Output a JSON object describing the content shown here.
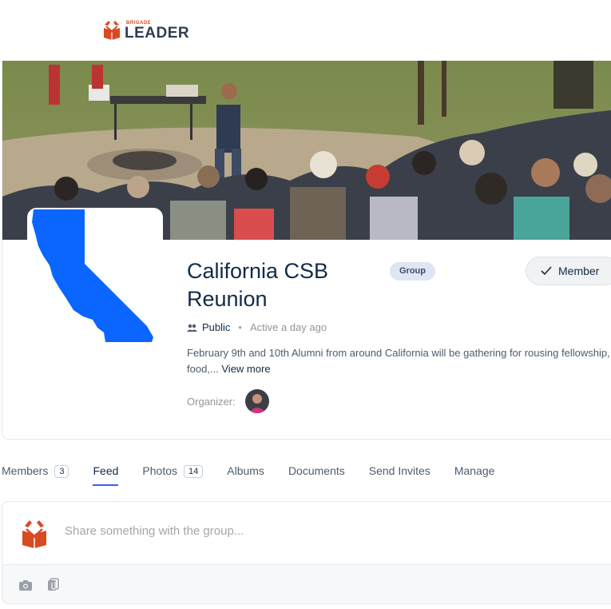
{
  "site": {
    "logo_small": "BRIGADE",
    "logo_big": "LEADER",
    "brand_color": "#d84a20"
  },
  "group": {
    "title_line1": "California CSB",
    "title_line2": "Reunion",
    "type_badge": "Group",
    "member_button": "Member",
    "privacy": "Public",
    "activity": "Active a day ago",
    "description_line1": "February 9th and 10th Alumni from around California will be gathering for rousing fellowship,",
    "description_line2": "food,...",
    "view_more": "View more",
    "organizer_label": "Organizer:"
  },
  "tabs": [
    {
      "label": "Members",
      "count": "3"
    },
    {
      "label": "Feed"
    },
    {
      "label": "Photos",
      "count": "14"
    },
    {
      "label": "Albums"
    },
    {
      "label": "Documents"
    },
    {
      "label": "Send Invites"
    },
    {
      "label": "Manage"
    }
  ],
  "active_tab": "Feed",
  "composer": {
    "placeholder": "Share something with the group..."
  },
  "icons": [
    "check-icon",
    "users-icon",
    "camera-icon",
    "attachment-icon"
  ],
  "colors": {
    "accent": "#385dff",
    "california_blue": "#0a66ff",
    "text": "#122b46"
  }
}
